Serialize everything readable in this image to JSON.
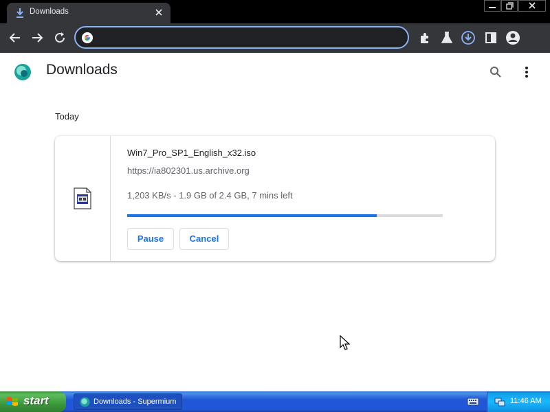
{
  "browser": {
    "tab": {
      "title": "Downloads",
      "icon": "download-icon"
    },
    "window_controls": [
      "minimize-icon",
      "restore-icon",
      "close-icon"
    ],
    "toolbar": {
      "back_icon": "back-arrow-icon",
      "forward_icon": "forward-arrow-icon",
      "reload_icon": "reload-icon",
      "omnibox": {
        "value": "",
        "placeholder": "",
        "icon": "google-icon"
      },
      "right_icons": [
        "extensions-icon",
        "labs-flask-icon",
        "downloads-active-icon",
        "side-panel-icon",
        "profile-icon"
      ]
    },
    "colors": {
      "accent": "#8ab4f8",
      "frame": "#35363a"
    }
  },
  "page": {
    "title": "Downloads",
    "header_icons": [
      "search-icon",
      "more-vert-icon"
    ],
    "section_date": "Today",
    "download": {
      "file_name": "Win7_Pro_SP1_English_x32.iso",
      "source_url": "https://ia802301.us.archive.org",
      "status": "1,203 KB/s - 1.9 GB of 2.4 GB, 7 mins left",
      "progress_fraction": 0.79,
      "pause_label": "Pause",
      "cancel_label": "Cancel",
      "file_icon": "iso-file-icon"
    },
    "colors": {
      "progress": "#1a73e8"
    }
  },
  "taskbar": {
    "start_label": "start",
    "task_item_label": "Downloads - Supermium",
    "clock": "11:46 AM"
  }
}
